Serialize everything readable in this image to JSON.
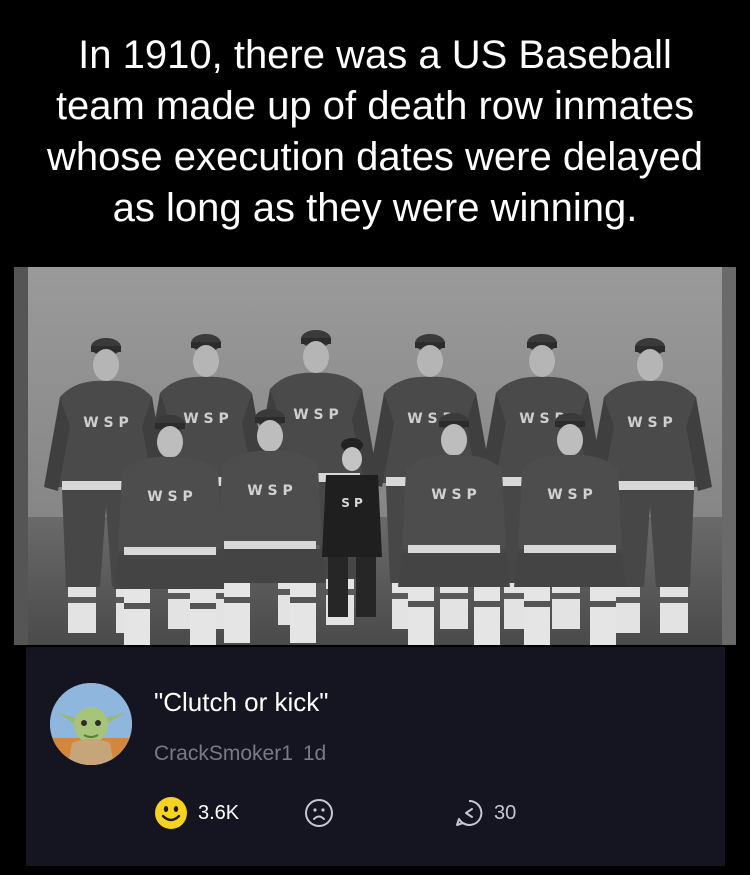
{
  "headline": {
    "lines": [
      "In 1910, there was a US Baseball",
      "team made up of death row inmates",
      "whose execution dates were delayed",
      "as long as they were winning."
    ]
  },
  "photo": {
    "description_icon": "team-photo",
    "jersey_letters": "WSP"
  },
  "comment": {
    "text": "\"Clutch or kick\"",
    "username": "CrackSmoker1",
    "time": "1d",
    "avatar_icon": "yoda-avatar"
  },
  "actions": {
    "like_icon": "smile-emoji-icon",
    "like_count": "3.6K",
    "dislike_icon": "sad-face-icon",
    "reply_icon": "reply-icon",
    "reply_count": "30"
  },
  "colors": {
    "background": "#000000",
    "card": "#151521",
    "emoji_yellow": "#f6d31f",
    "muted": "#7a7a86"
  }
}
